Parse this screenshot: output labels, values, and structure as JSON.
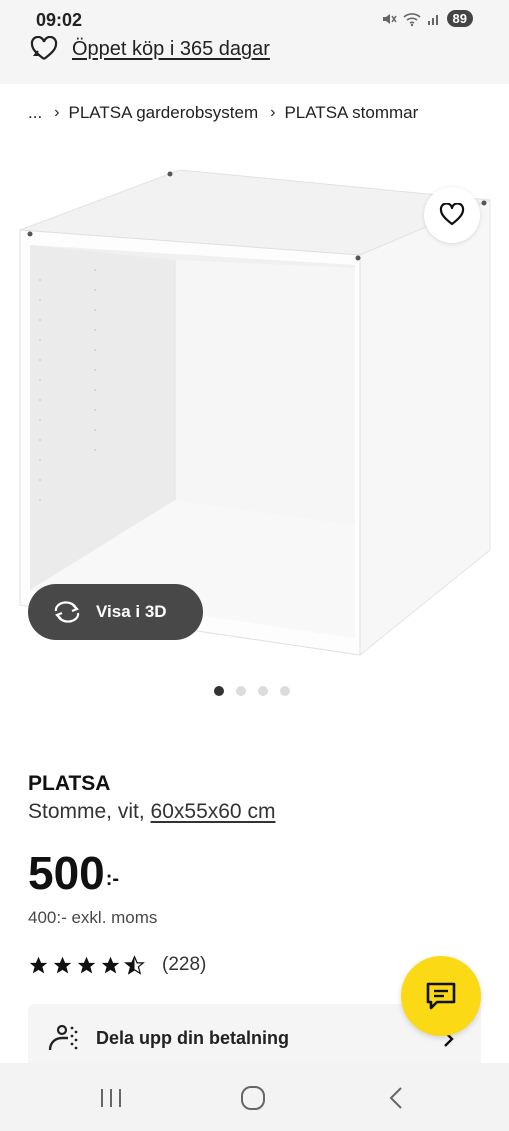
{
  "status_bar": {
    "time": "09:02",
    "battery": "89",
    "mute_icon": "mute-icon",
    "wifi_icon": "wifi-icon",
    "signal_icon": "signal-icon"
  },
  "promo": {
    "icon": "heart-return-icon",
    "text": "Öppet köp i 365 dagar"
  },
  "breadcrumb": {
    "ellipsis": "...",
    "items": [
      "PLATSA garderobsystem",
      "PLATSA stommar"
    ],
    "separator": "›"
  },
  "gallery": {
    "image": "white-cabinet-frame",
    "favorite_icon": "heart-outline-icon",
    "view3d_label": "Visa i 3D",
    "view3d_icon": "rotate-3d-icon",
    "dots_total": 4,
    "active_dot": 0
  },
  "product": {
    "name": "PLATSA",
    "description_prefix": "Stomme, vit, ",
    "size": "60x55x60 cm",
    "price": "500",
    "price_suffix": ":-",
    "price_excl": "400:- exkl. moms"
  },
  "rating": {
    "stars": 4.5,
    "max": 5,
    "count": "(228)"
  },
  "split_payment": {
    "icon": "split-payment-icon",
    "label": "Dela upp din betalning",
    "chevron_icon": "chevron-right-icon"
  },
  "chat": {
    "icon": "chat-icon"
  },
  "system_nav": {
    "recents_icon": "recents-icon",
    "home_icon": "home-icon",
    "back_icon": "back-icon"
  },
  "colors": {
    "accent_yellow": "#fbd914",
    "dark_button": "#484848",
    "card_bg": "#f5f5f5"
  }
}
